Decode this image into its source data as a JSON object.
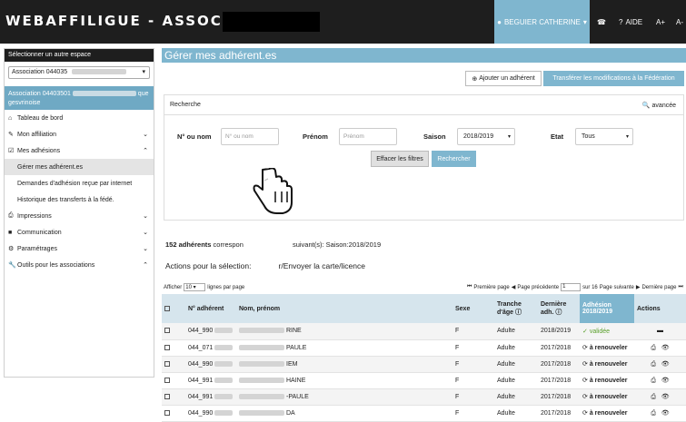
{
  "header": {
    "brand": "WEBAFFILIGUE - ASSOCIATION",
    "user": "BEGUIER CATHERINE",
    "help": "AIDE",
    "font_up": "A+",
    "font_down": "A-"
  },
  "sidebar": {
    "head": "Sélectionner un autre espace",
    "select_value": "Association 044035",
    "assoc_line1": "Association 04403501",
    "assoc_line1b": "que",
    "assoc_line2": "gesvrinoise",
    "items": [
      {
        "label": "Tableau de bord",
        "icon": "home-icon"
      },
      {
        "label": "Mon affiliation",
        "icon": "pencil-icon"
      },
      {
        "label": "Mes adhésions",
        "icon": "check-square-icon"
      }
    ],
    "subitems": [
      "Gérer mes adhérent.es",
      "Demandes d'adhésion reçue par internet",
      "Historique des transferts à la fédé."
    ],
    "items2": [
      {
        "label": "Impressions",
        "icon": "print-icon"
      },
      {
        "label": "Communication",
        "icon": "comment-icon"
      },
      {
        "label": "Paramétrages",
        "icon": "gear-icon"
      },
      {
        "label": "Outils pour les associations",
        "icon": "wrench-icon"
      }
    ]
  },
  "main": {
    "title": "Gérer mes adhérent.es",
    "add_button": "Ajouter un adhérent",
    "transfer_button": "Transférer les modifications à la Fédération",
    "search": {
      "title": "Recherche",
      "advanced": "avancée",
      "label_nom": "N° ou nom",
      "placeholder_nom": "N° ou nom",
      "label_prenom": "Prénom",
      "placeholder_prenom": "Prénom",
      "label_saison": "Saison",
      "saison_value": "2018/2019",
      "label_etat": "Etat",
      "etat_value": "Tous",
      "clear_button": "Effacer les filtres",
      "search_button": "Rechercher"
    },
    "count_bold": "152 adhérents",
    "count_rest": " correspon",
    "count_tail": " suivant(s): Saison:2018/2019",
    "actions_label": "Actions pour la sélection:",
    "actions_tail": "r/Envoyer la carte/licence",
    "perpage_pre": "Afficher",
    "perpage_value": "10",
    "perpage_post": "lignes par page",
    "pager": {
      "first": "Première page",
      "prev": "Page précédente",
      "page": "1",
      "of": "sur 16",
      "next": "Page suivante",
      "last": "Dernière page"
    }
  },
  "table": {
    "headers": {
      "num": "N° adhérent",
      "name": "Nom, prénom",
      "sexe": "Sexe",
      "tranche": "Tranche d'âge",
      "derniere": "Dernière adh.",
      "adhesion": "Adhésion 2018/2019",
      "actions": "Actions"
    },
    "rows": [
      {
        "num": "044_990",
        "name": "RINE",
        "sexe": "F",
        "tranche": "Adulte",
        "derniere": "2018/2019",
        "status": "validée"
      },
      {
        "num": "044_071",
        "name": "PAULE",
        "sexe": "F",
        "tranche": "Adulte",
        "derniere": "2017/2018",
        "status": "à renouveler"
      },
      {
        "num": "044_990",
        "name": "IEM",
        "sexe": "F",
        "tranche": "Adulte",
        "derniere": "2017/2018",
        "status": "à renouveler"
      },
      {
        "num": "044_991",
        "name": "HAINE",
        "sexe": "F",
        "tranche": "Adulte",
        "derniere": "2017/2018",
        "status": "à renouveler"
      },
      {
        "num": "044_991",
        "name": "-PAULE",
        "sexe": "F",
        "tranche": "Adulte",
        "derniere": "2017/2018",
        "status": "à renouveler"
      },
      {
        "num": "044_990",
        "name": "DA",
        "sexe": "F",
        "tranche": "Adulte",
        "derniere": "2017/2018",
        "status": "à renouveler"
      }
    ]
  }
}
